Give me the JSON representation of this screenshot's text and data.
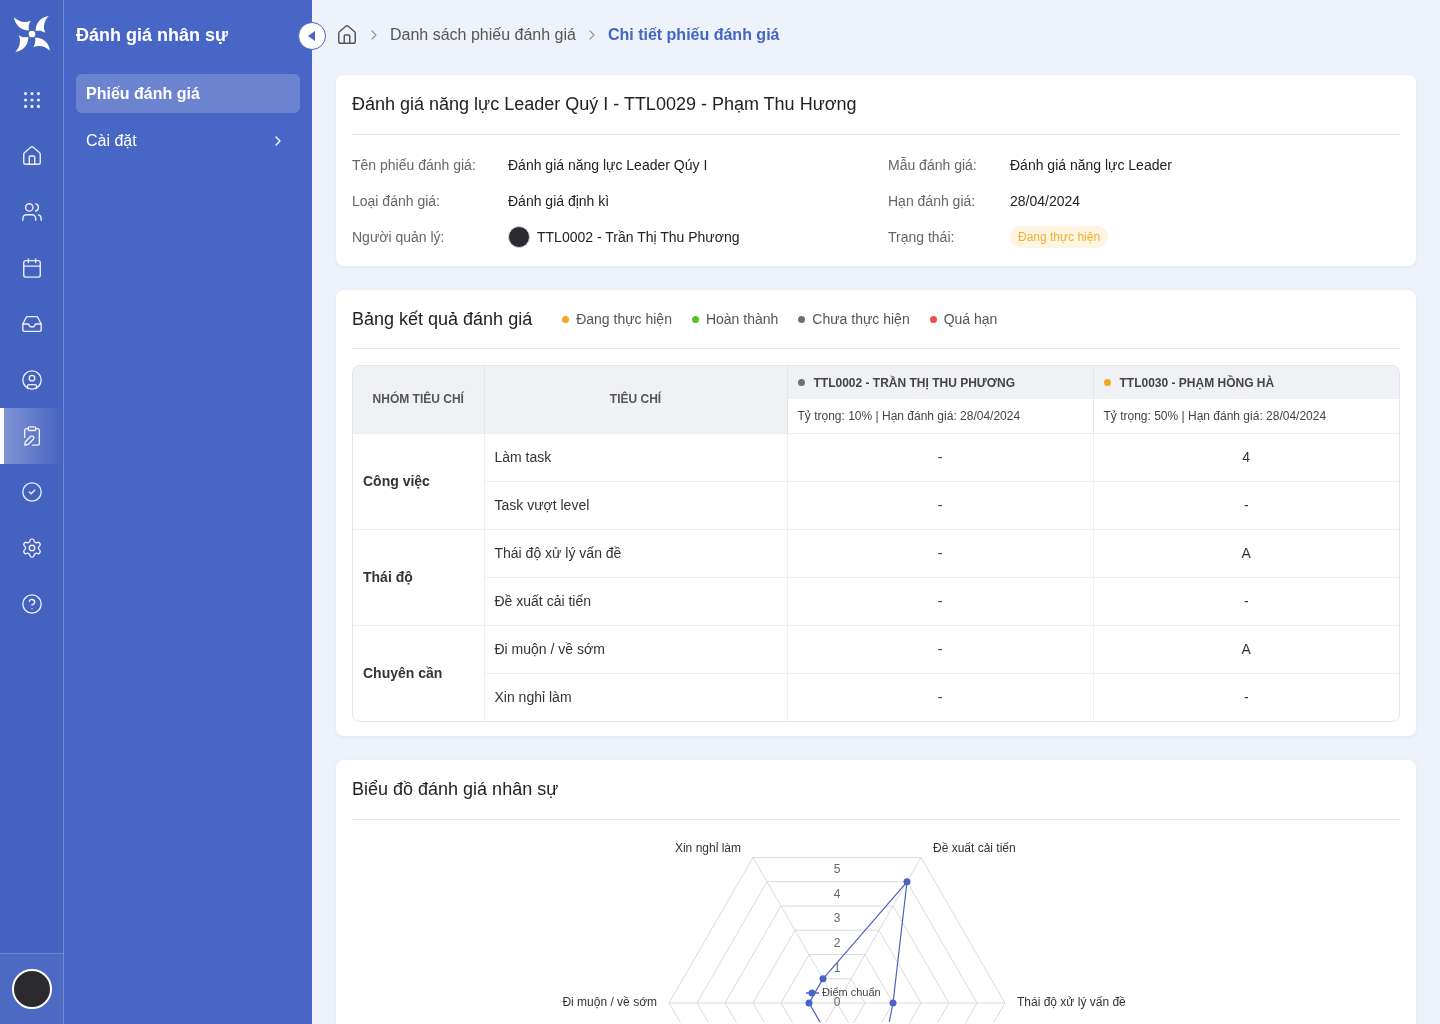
{
  "rail": {
    "items": [
      {
        "selected": false
      },
      {
        "selected": false
      },
      {
        "selected": false
      },
      {
        "selected": false
      },
      {
        "selected": false
      },
      {
        "selected": false
      },
      {
        "selected": true
      },
      {
        "selected": false
      },
      {
        "selected": false
      },
      {
        "selected": false
      }
    ]
  },
  "module": {
    "title": "Đánh giá nhân sự",
    "menu": [
      {
        "label": "Phiếu đánh giá",
        "selected": true,
        "has_submenu": false
      },
      {
        "label": "Cài đặt",
        "selected": false,
        "has_submenu": true
      }
    ]
  },
  "breadcrumb": [
    {
      "label": "Danh sách phiếu đánh giá",
      "current": false
    },
    {
      "label": "Chi tiết phiếu đánh giá",
      "current": true
    }
  ],
  "info_card": {
    "title": "Đánh giá năng lực Leader Quý I - TTL0029 - Phạm Thu Hương",
    "fields": [
      {
        "label": "Tên phiếu đánh giá:",
        "value": "Đánh giá năng lực Leader Qúy I",
        "kind": "text"
      },
      {
        "label": "Mẫu đánh giá:",
        "value": "Đánh giá năng lực Leader",
        "kind": "text"
      },
      {
        "label": "Loại đánh giá:",
        "value": "Đánh giá định kì",
        "kind": "text"
      },
      {
        "label": "Hạn đánh giá:",
        "value": "28/04/2024",
        "kind": "text"
      },
      {
        "label": "Người quản lý:",
        "value": "TTL0002 - Trần Thị Thu Phương",
        "kind": "person"
      },
      {
        "label": "Trạng thái:",
        "value": "Đang thực hiện",
        "kind": "badge",
        "color": "#efb12a"
      }
    ]
  },
  "results": {
    "title": "Bảng kết quả đánh giá",
    "legend": [
      {
        "label": "Đang thực hiện",
        "color": "#f5a623"
      },
      {
        "label": "Hoàn thành",
        "color": "#52c41a"
      },
      {
        "label": "Chưa thực hiện",
        "color": "#6b6e7b"
      },
      {
        "label": "Quá hạn",
        "color": "#f04d4f"
      }
    ],
    "table": {
      "columns": [
        "NHÓM TIÊU CHÍ",
        "TIÊU CHÍ"
      ],
      "assessors": [
        {
          "name": "TTL0002 - TRẦN THỊ THU PHƯƠNG",
          "color": "#6b6e7b",
          "details": "Tỷ trọng: 10% | Hạn đánh giá: 28/04/2024"
        },
        {
          "name": "TTL0030 - PHẠM HỒNG HÀ",
          "color": "#f5a623",
          "details": "Tỷ trọng: 50% | Hạn đánh giá: 28/04/2024"
        }
      ],
      "groups": [
        {
          "name": "Công việc",
          "criteria": [
            {
              "name": "Làm task",
              "scores": [
                "-",
                "4"
              ]
            },
            {
              "name": "Task vượt level",
              "scores": [
                "-",
                "-"
              ]
            }
          ]
        },
        {
          "name": "Thái độ",
          "criteria": [
            {
              "name": "Thái độ xử lý vấn đề",
              "scores": [
                "-",
                "A"
              ]
            },
            {
              "name": "Đề xuất cải tiến",
              "scores": [
                "-",
                "-"
              ]
            }
          ]
        },
        {
          "name": "Chuyên cần",
          "criteria": [
            {
              "name": "Đi muộn / về sớm",
              "scores": [
                "-",
                "A"
              ]
            },
            {
              "name": "Xin nghỉ làm",
              "scores": [
                "-",
                "-"
              ]
            }
          ]
        }
      ]
    }
  },
  "chart_card": {
    "title": "Biểu đồ đánh giá nhân sự",
    "radar": {
      "axis_labels": [
        "Xin nghỉ làm",
        "Đề xuất cải tiến",
        "Đi muộn / về sớm",
        "Thái độ xử lý vấn đề"
      ],
      "scale_labels": [
        "5",
        "4",
        "3",
        "2",
        "1",
        "0"
      ],
      "series_label": "Điểm chuẩn"
    }
  }
}
